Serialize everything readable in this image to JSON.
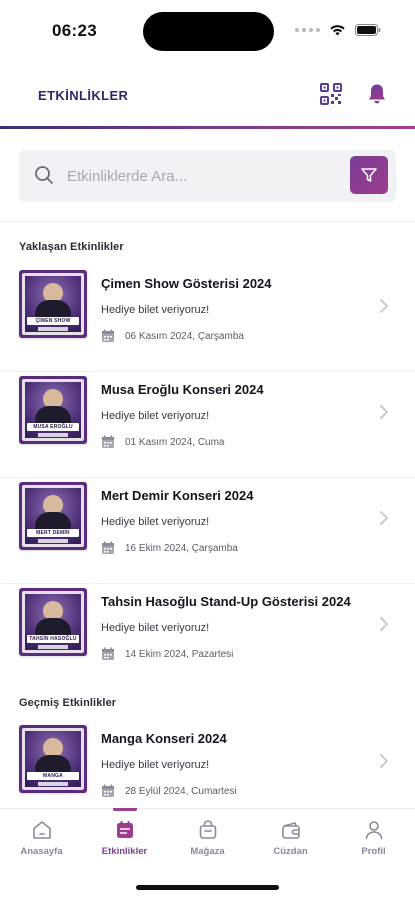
{
  "status_bar": {
    "time": "06:23"
  },
  "header": {
    "title": "ETKİNLİKLER",
    "qr_icon": "qr-code-icon",
    "bell_icon": "bell-icon"
  },
  "search": {
    "placeholder": "Etkinliklerde Ara...",
    "value": ""
  },
  "sections": {
    "upcoming_title": "Yaklaşan Etkinlikler",
    "past_title": "Geçmiş Etkinlikler"
  },
  "upcoming_events": [
    {
      "title": "Çimen Show Gösterisi 2024",
      "desc": "Hediye bilet veriyoruz!",
      "date": "06 Kasım 2024, Çarşamba",
      "banner": "ÇİMEN SHOW"
    },
    {
      "title": "Musa Eroğlu Konseri 2024",
      "desc": "Hediye bilet veriyoruz!",
      "date": "01 Kasım 2024, Cuma",
      "banner": "MUSA EROĞLU"
    },
    {
      "title": "Mert Demir Konseri 2024",
      "desc": "Hediye bilet veriyoruz!",
      "date": "16 Ekim 2024, Çarşamba",
      "banner": "MERT DEMİR"
    },
    {
      "title": "Tahsin Hasoğlu Stand-Up Gösterisi 2024",
      "desc": "Hediye bilet veriyoruz!",
      "date": "14 Ekim 2024, Pazartesi",
      "banner": "TAHSİN HASOĞLU"
    }
  ],
  "past_events": [
    {
      "title": "Manga Konseri 2024",
      "desc": "Hediye bilet veriyoruz!",
      "date": "28 Eylül 2024, Cumartesi",
      "banner": "MANGA"
    }
  ],
  "tabs": [
    {
      "label": "Anasayfa",
      "icon": "home-icon",
      "active": false
    },
    {
      "label": "Etkinlikler",
      "icon": "calendar-icon",
      "active": true
    },
    {
      "label": "Mağaza",
      "icon": "shopping-bag-icon",
      "active": false
    },
    {
      "label": "Cüzdan",
      "icon": "wallet-icon",
      "active": false
    },
    {
      "label": "Profil",
      "icon": "user-icon",
      "active": false
    }
  ],
  "colors": {
    "accent": "#9c3d8c",
    "header_title": "#2b2a6a",
    "tab_active": "#7d3d93"
  }
}
